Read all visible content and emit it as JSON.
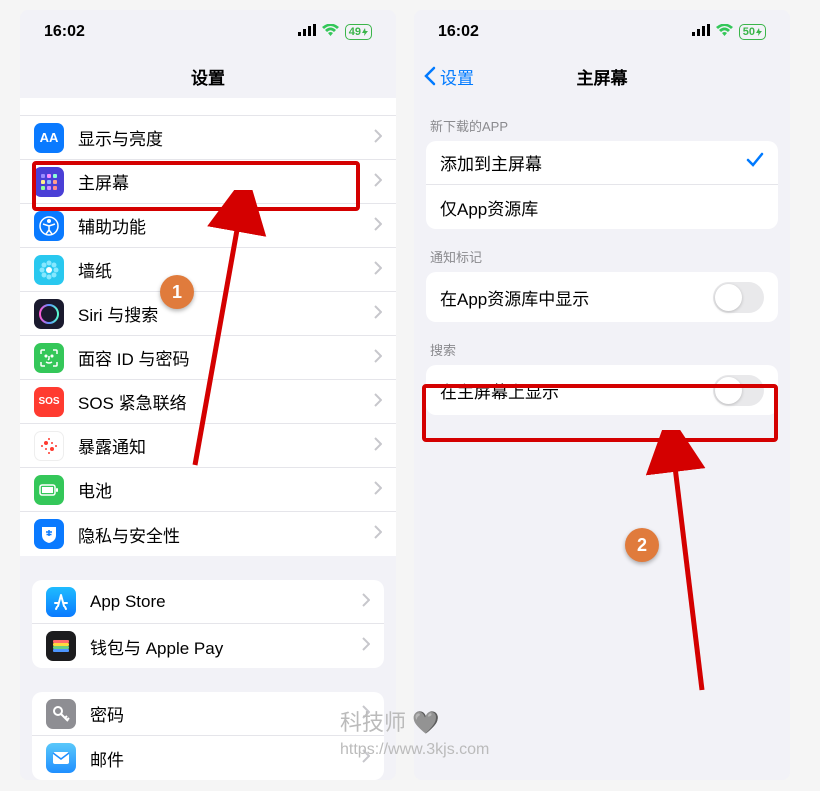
{
  "left": {
    "status": {
      "time": "16:02",
      "battery": "49"
    },
    "title": "设置",
    "rows": [
      {
        "label": "显示与亮度",
        "iconBg": "#0a7aff",
        "iconText": "AA"
      },
      {
        "label": "主屏幕",
        "iconBg": "#4a3fd6",
        "iconGrid": true
      },
      {
        "label": "辅助功能",
        "iconBg": "#0a7aff",
        "iconAccess": true
      },
      {
        "label": "墙纸",
        "iconBg": "#29c8ef",
        "iconFlower": true
      },
      {
        "label": "Siri 与搜索",
        "iconBg": "#1a1a2e",
        "iconSiri": true
      },
      {
        "label": "面容 ID 与密码",
        "iconBg": "#34c759",
        "iconFace": true
      },
      {
        "label": "SOS 紧急联络",
        "iconBg": "#ff3b30",
        "iconText": "SOS"
      },
      {
        "label": "暴露通知",
        "iconBg": "#ffffff",
        "iconCovid": true
      },
      {
        "label": "电池",
        "iconBg": "#34c759",
        "iconBattery": true
      },
      {
        "label": "隐私与安全性",
        "iconBg": "#0a7aff",
        "iconHand": true
      }
    ],
    "rows2": [
      {
        "label": "App Store",
        "iconBg": "#0a7aff",
        "iconStore": true
      },
      {
        "label": "钱包与 Apple Pay",
        "iconBg": "#1c1c1e",
        "iconWallet": true
      }
    ],
    "rows3": [
      {
        "label": "密码",
        "iconBg": "#8e8e93",
        "iconKey": true
      },
      {
        "label": "邮件",
        "iconBg": "#1f8fff",
        "iconMail": true
      }
    ]
  },
  "right": {
    "status": {
      "time": "16:02",
      "battery": "50"
    },
    "back": "设置",
    "title": "主屏幕",
    "section1_header": "新下载的APP",
    "section1": [
      {
        "label": "添加到主屏幕",
        "checked": true
      },
      {
        "label": "仅App资源库",
        "checked": false
      }
    ],
    "section2_header": "通知标记",
    "section2": {
      "label": "在App资源库中显示"
    },
    "section3_header": "搜索",
    "section3": {
      "label": "在主屏幕上显示"
    }
  },
  "annotations": {
    "badge1": "1",
    "badge2": "2"
  },
  "watermark": {
    "name": "科技师",
    "url": "https://www.3kjs.com"
  }
}
